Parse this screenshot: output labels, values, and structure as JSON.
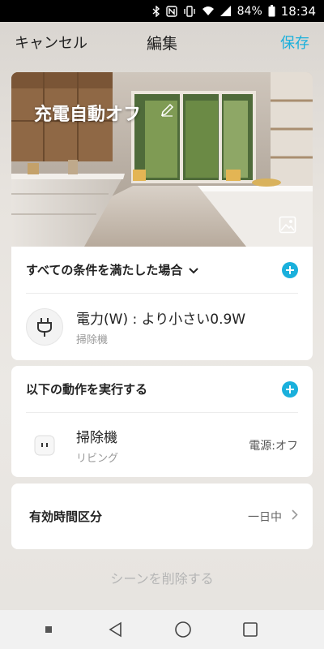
{
  "status_bar": {
    "battery": "84%",
    "time": "18:34",
    "icons": [
      "bluetooth-icon",
      "nfc-icon",
      "vibrate-icon",
      "wifi-icon",
      "signal-icon",
      "battery-icon"
    ]
  },
  "nav": {
    "cancel_label": "キャンセル",
    "title": "編集",
    "save_label": "保存",
    "accent_color": "#1ab0dc"
  },
  "scene": {
    "name": "充電自動オフ",
    "edit_icon": "pencil-icon",
    "image_icon": "image-icon"
  },
  "conditions": {
    "header": "すべての条件を満たした場合",
    "items": [
      {
        "title": "電力(W) : より小さい0.9W",
        "device": "掃除機",
        "icon": "plug-icon"
      }
    ]
  },
  "actions": {
    "header": "以下の動作を実行する",
    "items": [
      {
        "title": "掃除機",
        "room": "リビング",
        "state": "電源:オフ",
        "icon": "smart-plug-icon"
      }
    ]
  },
  "effective_period": {
    "label": "有効時間区分",
    "value": "一日中"
  },
  "delete_label": "シーンを削除する",
  "system_nav": [
    "recent-dot-icon",
    "back-icon",
    "home-icon",
    "overview-icon"
  ]
}
